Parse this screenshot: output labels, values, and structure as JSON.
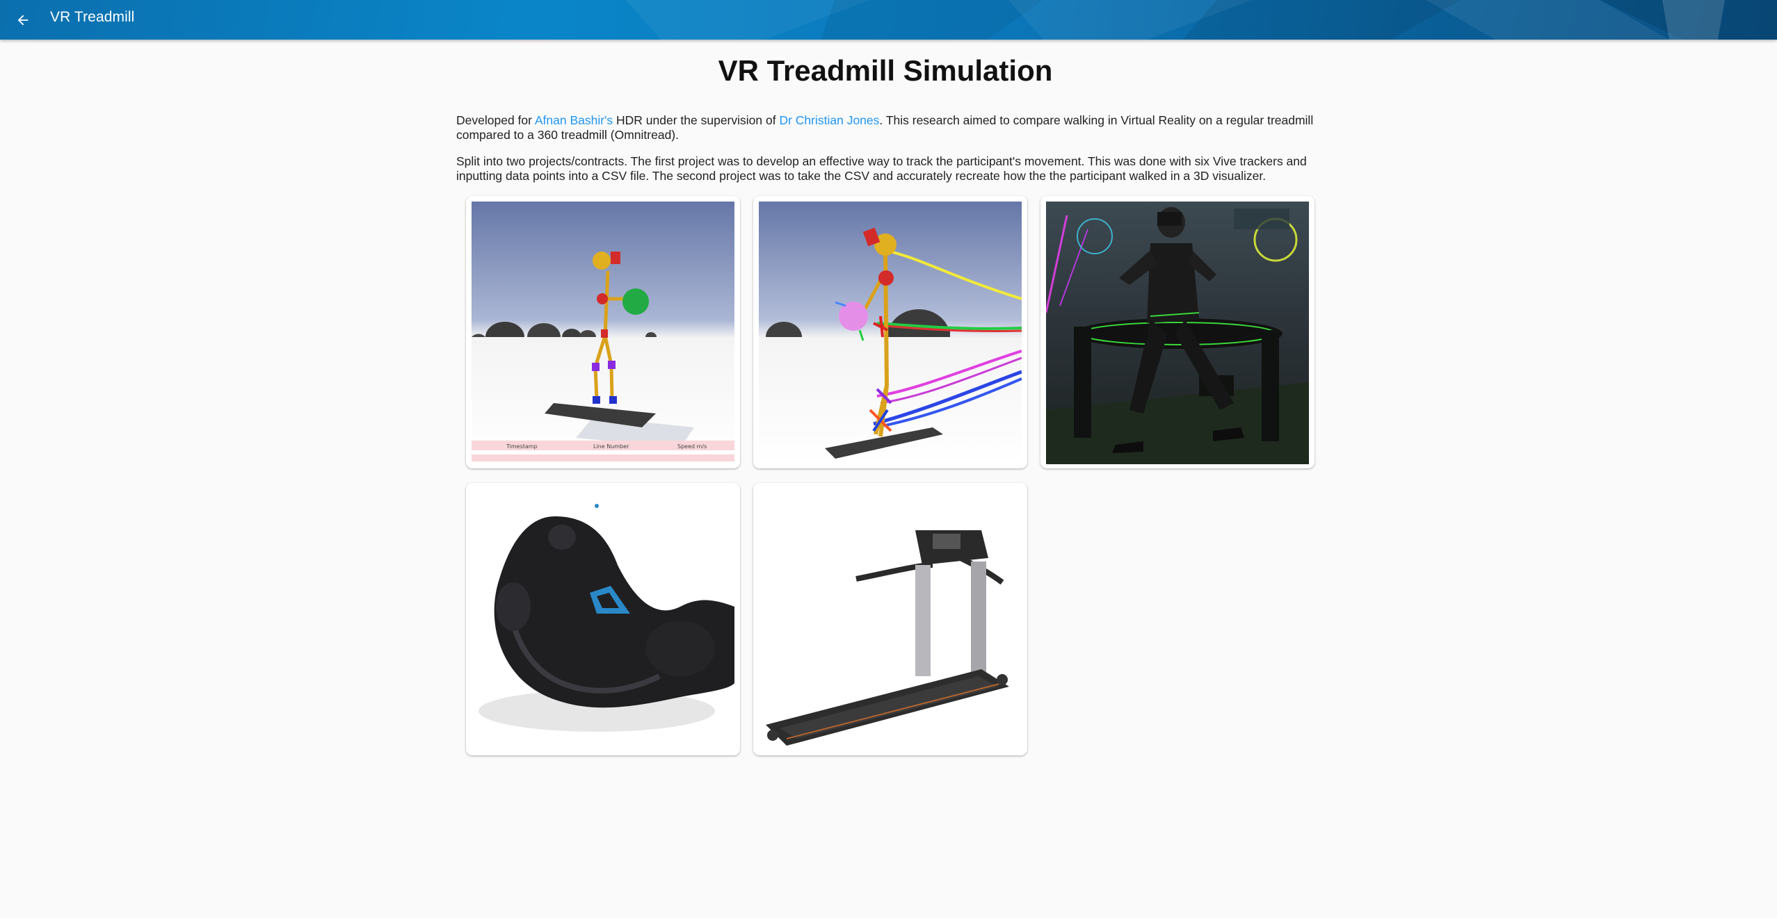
{
  "appbar": {
    "title": "VR Treadmill",
    "back_icon": "arrow-back-icon",
    "colors": {
      "primary": "#0a86c8",
      "dark": "#0a4f82"
    }
  },
  "page": {
    "title": "VR Treadmill Simulation",
    "intro": {
      "prefix": "Developed for ",
      "link1": "Afnan Bashir's",
      "middle": " HDR under the supervision of ",
      "link2": "Dr Christian Jones",
      "suffix": ". This research aimed to compare walking in Virtual Reality on a regular treadmill compared to a 360 treadmill (Omnitread)."
    },
    "details": "Split into two projects/contracts. The first project was to develop an effective way to track the participant's movement. This was done with six Vive trackers and inputting data points into a CSV file. The second project was to take the CSV and accurately recreate how the the participant walked in a 3D visualizer.",
    "link_color": "#2196f3"
  },
  "gallery": {
    "card1_table_headers": [
      "Timestamp",
      "Line Number",
      "Speed m/s"
    ]
  }
}
